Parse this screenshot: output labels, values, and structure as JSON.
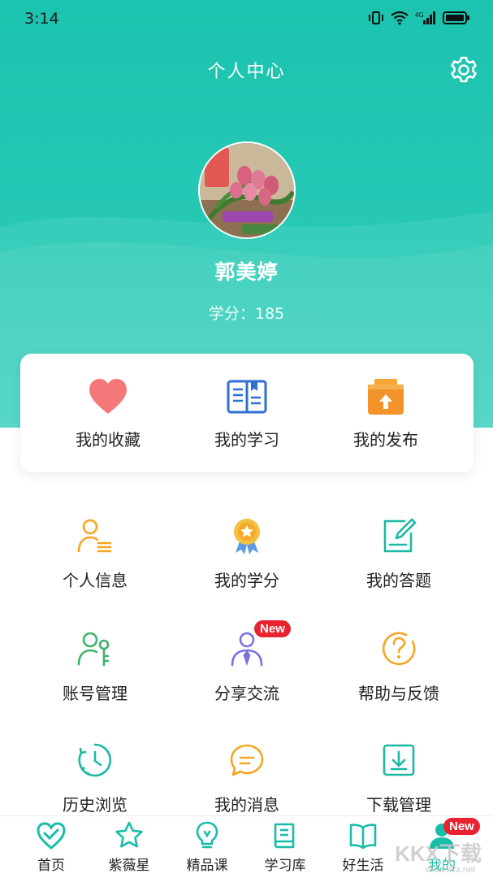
{
  "status": {
    "time": "3:14"
  },
  "header": {
    "title": "个人中心"
  },
  "profile": {
    "name": "郭美婷",
    "credits_label": "学分：185"
  },
  "quick_actions": [
    {
      "label": "我的收藏",
      "icon": "heart-icon"
    },
    {
      "label": "我的学习",
      "icon": "book-icon"
    },
    {
      "label": "我的发布",
      "icon": "upload-box-icon"
    }
  ],
  "menu": [
    {
      "label": "个人信息",
      "icon": "user-info-icon"
    },
    {
      "label": "我的学分",
      "icon": "medal-icon"
    },
    {
      "label": "我的答题",
      "icon": "edit-icon"
    },
    {
      "label": "账号管理",
      "icon": "user-key-icon"
    },
    {
      "label": "分享交流",
      "icon": "share-person-icon",
      "badge": "New"
    },
    {
      "label": "帮助与反馈",
      "icon": "help-icon"
    },
    {
      "label": "历史浏览",
      "icon": "history-icon"
    },
    {
      "label": "我的消息",
      "icon": "message-icon"
    },
    {
      "label": "下载管理",
      "icon": "download-icon"
    }
  ],
  "nav": [
    {
      "label": "首页",
      "icon": "home-heart-icon"
    },
    {
      "label": "紫薇星",
      "icon": "star-icon"
    },
    {
      "label": "精品课",
      "icon": "bulb-icon"
    },
    {
      "label": "学习库",
      "icon": "library-icon"
    },
    {
      "label": "好生活",
      "icon": "open-book-icon"
    },
    {
      "label": "我的",
      "icon": "profile-icon",
      "badge": "New",
      "active": true
    }
  ],
  "watermark": {
    "logo": "KKX下载",
    "url": "www.kkx.net"
  },
  "colors": {
    "accent": "#1cc3ae",
    "badge": "#e8232f"
  }
}
